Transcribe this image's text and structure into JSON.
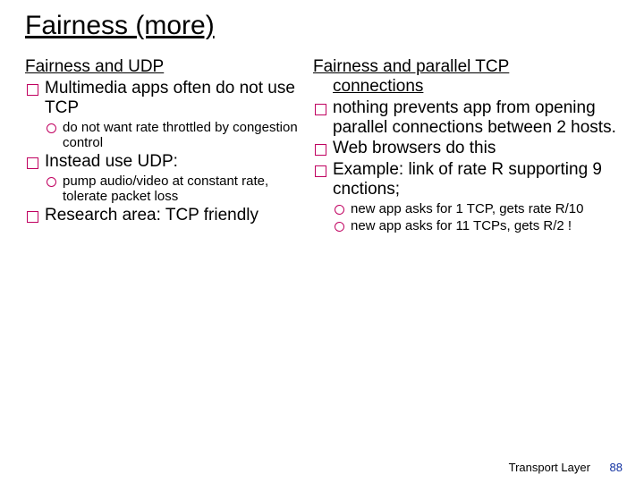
{
  "title": "Fairness (more)",
  "left": {
    "heading": "Fairness and UDP",
    "items": [
      {
        "text": "Multimedia apps often do not use TCP",
        "sub": [
          "do not want rate throttled by congestion control"
        ]
      },
      {
        "text": "Instead use UDP:",
        "sub": [
          "pump audio/video at constant rate, tolerate packet loss"
        ]
      },
      {
        "text": "Research area: TCP friendly",
        "sub": []
      }
    ]
  },
  "right": {
    "heading_l1": "Fairness and parallel TCP",
    "heading_l2": "connections",
    "items": [
      {
        "text": "nothing prevents app from opening parallel connections between 2 hosts.",
        "sub": []
      },
      {
        "text": "Web browsers do this",
        "sub": []
      },
      {
        "text": "Example: link of rate R supporting 9 cnctions;",
        "sub": [
          "new app asks for 1 TCP, gets rate R/10",
          "new app asks for 11 TCPs, gets R/2 !"
        ]
      }
    ]
  },
  "footer": {
    "section": "Transport Layer",
    "page": "88"
  }
}
